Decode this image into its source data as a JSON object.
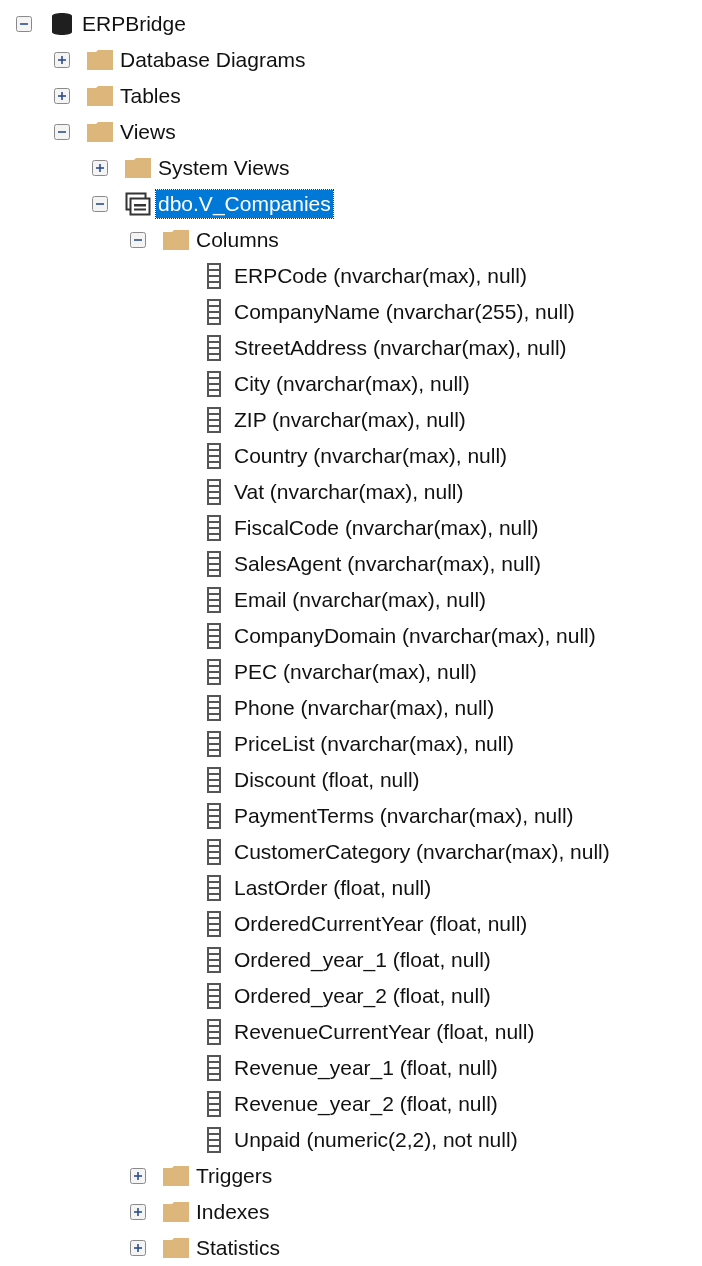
{
  "tree": [
    {
      "kind": "database",
      "label": "ERPBridge",
      "expanded": true,
      "selected": false,
      "children": [
        {
          "kind": "folder",
          "label": "Database Diagrams",
          "expanded": false,
          "selected": false
        },
        {
          "kind": "folder",
          "label": "Tables",
          "expanded": false,
          "selected": false
        },
        {
          "kind": "folder",
          "label": "Views",
          "expanded": true,
          "selected": false,
          "children": [
            {
              "kind": "folder",
              "label": "System Views",
              "expanded": false,
              "selected": false
            },
            {
              "kind": "view",
              "label": "dbo.V_Companies",
              "expanded": true,
              "selected": true,
              "children": [
                {
                  "kind": "folder",
                  "label": "Columns",
                  "expanded": true,
                  "selected": false,
                  "children": [
                    {
                      "kind": "column",
                      "label": "ERPCode (nvarchar(max), null)",
                      "selected": false
                    },
                    {
                      "kind": "column",
                      "label": "CompanyName (nvarchar(255), null)",
                      "selected": false
                    },
                    {
                      "kind": "column",
                      "label": "StreetAddress (nvarchar(max), null)",
                      "selected": false
                    },
                    {
                      "kind": "column",
                      "label": "City (nvarchar(max), null)",
                      "selected": false
                    },
                    {
                      "kind": "column",
                      "label": "ZIP (nvarchar(max), null)",
                      "selected": false
                    },
                    {
                      "kind": "column",
                      "label": "Country (nvarchar(max), null)",
                      "selected": false
                    },
                    {
                      "kind": "column",
                      "label": "Vat (nvarchar(max), null)",
                      "selected": false
                    },
                    {
                      "kind": "column",
                      "label": "FiscalCode (nvarchar(max), null)",
                      "selected": false
                    },
                    {
                      "kind": "column",
                      "label": "SalesAgent (nvarchar(max), null)",
                      "selected": false
                    },
                    {
                      "kind": "column",
                      "label": "Email (nvarchar(max), null)",
                      "selected": false
                    },
                    {
                      "kind": "column",
                      "label": "CompanyDomain (nvarchar(max), null)",
                      "selected": false
                    },
                    {
                      "kind": "column",
                      "label": "PEC (nvarchar(max), null)",
                      "selected": false
                    },
                    {
                      "kind": "column",
                      "label": "Phone (nvarchar(max), null)",
                      "selected": false
                    },
                    {
                      "kind": "column",
                      "label": "PriceList (nvarchar(max), null)",
                      "selected": false
                    },
                    {
                      "kind": "column",
                      "label": "Discount (float, null)",
                      "selected": false
                    },
                    {
                      "kind": "column",
                      "label": "PaymentTerms (nvarchar(max), null)",
                      "selected": false
                    },
                    {
                      "kind": "column",
                      "label": "CustomerCategory (nvarchar(max), null)",
                      "selected": false
                    },
                    {
                      "kind": "column",
                      "label": "LastOrder (float, null)",
                      "selected": false
                    },
                    {
                      "kind": "column",
                      "label": "OrderedCurrentYear (float, null)",
                      "selected": false
                    },
                    {
                      "kind": "column",
                      "label": "Ordered_year_1 (float, null)",
                      "selected": false
                    },
                    {
                      "kind": "column",
                      "label": "Ordered_year_2 (float, null)",
                      "selected": false
                    },
                    {
                      "kind": "column",
                      "label": "RevenueCurrentYear (float, null)",
                      "selected": false
                    },
                    {
                      "kind": "column",
                      "label": "Revenue_year_1 (float, null)",
                      "selected": false
                    },
                    {
                      "kind": "column",
                      "label": "Revenue_year_2 (float, null)",
                      "selected": false
                    },
                    {
                      "kind": "column",
                      "label": "Unpaid (numeric(2,2), not null)",
                      "selected": false
                    }
                  ]
                },
                {
                  "kind": "folder",
                  "label": "Triggers",
                  "expanded": false,
                  "selected": false
                },
                {
                  "kind": "folder",
                  "label": "Indexes",
                  "expanded": false,
                  "selected": false
                },
                {
                  "kind": "folder",
                  "label": "Statistics",
                  "expanded": false,
                  "selected": false
                }
              ]
            }
          ]
        }
      ]
    }
  ]
}
